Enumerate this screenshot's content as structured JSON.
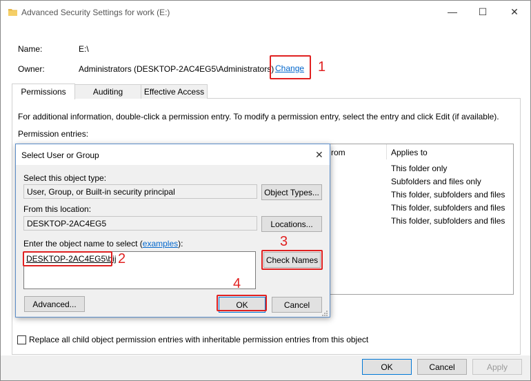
{
  "window": {
    "title": "Advanced Security Settings for work (E:)",
    "minimize": "—",
    "maximize": "☐",
    "close": "✕"
  },
  "info": {
    "name_label": "Name:",
    "name_value": "E:\\",
    "owner_label": "Owner:",
    "owner_value": "Administrators (DESKTOP-2AC4EG5\\Administrators)",
    "change_link": "Change"
  },
  "tabs": [
    {
      "label": "Permissions"
    },
    {
      "label": "Auditing"
    },
    {
      "label": "Effective Access"
    }
  ],
  "permissions": {
    "info_text": "For additional information, double-click a permission entry. To modify a permission entry, select the entry and click Edit (if available).",
    "entries_label": "Permission entries:",
    "col_partial": "rom",
    "col_applies": "Applies to",
    "rows": [
      {
        "applies": "This folder only"
      },
      {
        "applies": "Subfolders and files only"
      },
      {
        "applies": "This folder, subfolders and files"
      },
      {
        "applies": "This folder, subfolders and files"
      },
      {
        "applies": "This folder, subfolders and files"
      }
    ],
    "replace_label": "Replace all child object permission entries with inheritable permission entries from this object"
  },
  "footer": {
    "ok": "OK",
    "cancel": "Cancel",
    "apply": "Apply"
  },
  "dialog": {
    "title": "Select User or Group",
    "close": "✕",
    "object_type_label": "Select this object type:",
    "object_type_value": "User, Group, or Built-in security principal",
    "object_types_button": "Object Types...",
    "location_label": "From this location:",
    "location_value": "DESKTOP-2AC4EG5",
    "locations_button": "Locations...",
    "enter_label_prefix": "Enter the object name to select (",
    "enter_label_link": "examples",
    "enter_label_suffix": "):",
    "object_name_value": "DESKTOP-2AC4EG5\\bij",
    "check_names_button": "Check Names",
    "advanced_button": "Advanced...",
    "ok_button": "OK",
    "cancel_button": "Cancel"
  },
  "annotations": {
    "n1": "1",
    "n2": "2",
    "n3": "3",
    "n4": "4"
  },
  "colors": {
    "annotation_red": "#e02020",
    "link_blue": "#0066cc",
    "focus_blue": "#0078d7"
  }
}
